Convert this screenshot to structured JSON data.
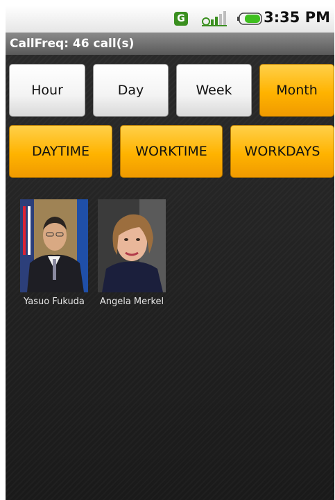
{
  "status_bar": {
    "g_badge": "G",
    "time": "3:35 PM",
    "icons": [
      "g-network-icon",
      "signal-icon",
      "battery-icon"
    ]
  },
  "title_bar": {
    "title": "CallFreq: 46 call(s)"
  },
  "period_buttons": [
    {
      "label": "Hour",
      "selected": false
    },
    {
      "label": "Day",
      "selected": false
    },
    {
      "label": "Week",
      "selected": false
    },
    {
      "label": "Month",
      "selected": true
    }
  ],
  "filter_buttons": [
    {
      "label": "DAYTIME",
      "selected": true
    },
    {
      "label": "WORKTIME",
      "selected": true
    },
    {
      "label": "WORKDAYS",
      "selected": true
    }
  ],
  "contacts": [
    {
      "name": "Yasuo Fukuda"
    },
    {
      "name": "Angela Merkel"
    }
  ],
  "colors": {
    "accent": "#ffb300",
    "background": "#1c1c1c",
    "status_green": "#3a8f1f"
  }
}
